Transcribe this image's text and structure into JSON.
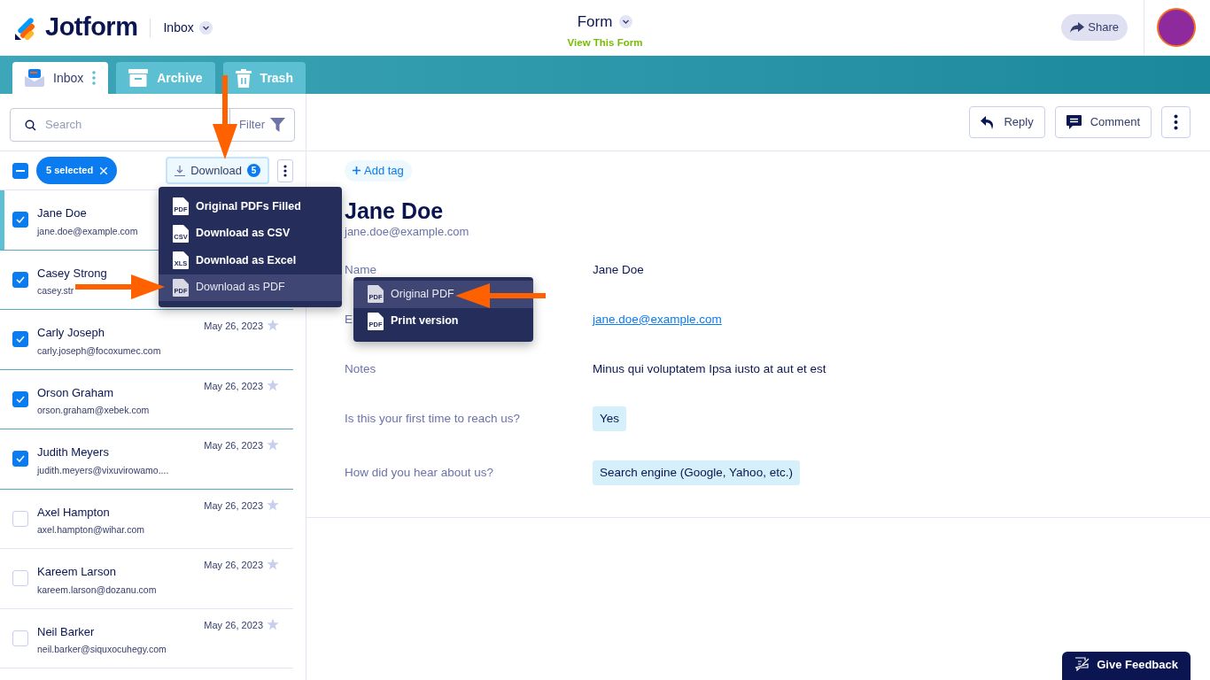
{
  "header": {
    "logo": "Jotform",
    "section": "Inbox",
    "form_title": "Form",
    "form_link": "View This Form",
    "share": "Share"
  },
  "tabs": [
    {
      "label": "Inbox",
      "selected": true
    },
    {
      "label": "Archive",
      "selected": false
    },
    {
      "label": "Trash",
      "selected": false
    }
  ],
  "search": {
    "placeholder": "Search",
    "filter": "Filter"
  },
  "selection": {
    "indeterminate": true,
    "count_label": "5 selected",
    "download": "Download",
    "download_count": "5"
  },
  "download_menu": [
    {
      "file_type": "PDF",
      "label": "Original PDFs Filled",
      "selected": false
    },
    {
      "file_type": "CSV",
      "label": "Download as CSV",
      "selected": false
    },
    {
      "file_type": "XLS",
      "label": "Download as Excel",
      "selected": false
    },
    {
      "file_type": "PDF",
      "label": "Download as PDF",
      "selected": true
    }
  ],
  "submissions": [
    {
      "name": "Jane Doe",
      "email": "jane.doe@example.com",
      "checked": true,
      "active": true
    },
    {
      "name": "Casey Strong",
      "email": "casey.str",
      "checked": true,
      "active": false
    },
    {
      "name": "Carly Joseph",
      "email": "carly.joseph@focoxumec.com",
      "date": "May 26, 2023",
      "checked": true,
      "active": false
    },
    {
      "name": "Orson Graham",
      "email": "orson.graham@xebek.com",
      "date": "May 26, 2023",
      "checked": true,
      "active": false
    },
    {
      "name": "Judith Meyers",
      "email": "judith.meyers@vixuvirowamo....",
      "date": "May 26, 2023",
      "checked": true,
      "active": false
    },
    {
      "name": "Axel Hampton",
      "email": "axel.hampton@wihar.com",
      "date": "May 26, 2023",
      "checked": false,
      "active": false
    },
    {
      "name": "Kareem Larson",
      "email": "kareem.larson@dozanu.com",
      "date": "May 26, 2023",
      "checked": false,
      "active": false
    },
    {
      "name": "Neil Barker",
      "email": "neil.barker@siquxocuhegy.com",
      "date": "May 26, 2023",
      "checked": false,
      "active": false
    }
  ],
  "actions": {
    "reply": "Reply",
    "comment": "Comment"
  },
  "detail": {
    "add_tag": "Add tag",
    "name": "Jane Doe",
    "email": "jane.doe@example.com",
    "fields": [
      {
        "kind": "text",
        "label": "Name",
        "value": "Jane Doe"
      },
      {
        "kind": "link",
        "label": "E",
        "value": "jane.doe@example.com"
      },
      {
        "kind": "text",
        "label": "Notes",
        "value": "Minus qui voluptatem Ipsa iusto at aut et est"
      },
      {
        "kind": "tag",
        "label": "Is this your first time to reach us?",
        "value": "Yes"
      },
      {
        "kind": "tag",
        "label": "How did you hear about us?",
        "value": "Search engine (Google, Yahoo, etc.)"
      }
    ]
  },
  "pdf_menu": [
    {
      "file_type": "PDF",
      "label": "Original PDF",
      "selected": true
    },
    {
      "file_type": "PDF",
      "label": "Print version",
      "selected": false
    }
  ],
  "feedback": "Give Feedback"
}
